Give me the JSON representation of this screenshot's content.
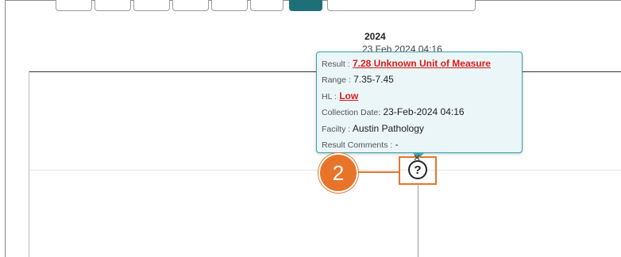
{
  "header": {
    "year": "2024",
    "date": "23 Feb 2024 04:16"
  },
  "toolbar": {
    "buttons": [
      "",
      "",
      "",
      "",
      "",
      "",
      "",
      ""
    ]
  },
  "tooltip": {
    "result_key": "Result :",
    "result_value": "7.28 Unknown Unit of Measure",
    "range_key": "Range :",
    "range_value": "7.35-7.45",
    "hl_key": "HL :",
    "hl_value": "Low",
    "collection_key": "Collection Date:",
    "collection_value": "23-Feb-2024 04:16",
    "facility_key": "Facilty :",
    "facility_value": "Austin Pathology",
    "comments_key": "Result Comments :",
    "comments_value": "-"
  },
  "callout": {
    "number": "2"
  },
  "marker": {
    "symbol": "?",
    "close_glyph": "✕"
  },
  "colors": {
    "accent": "#1f6f79",
    "tooltip_border": "#3aa6b0",
    "callout": "#e8742a",
    "alert": "#e01a1a"
  }
}
